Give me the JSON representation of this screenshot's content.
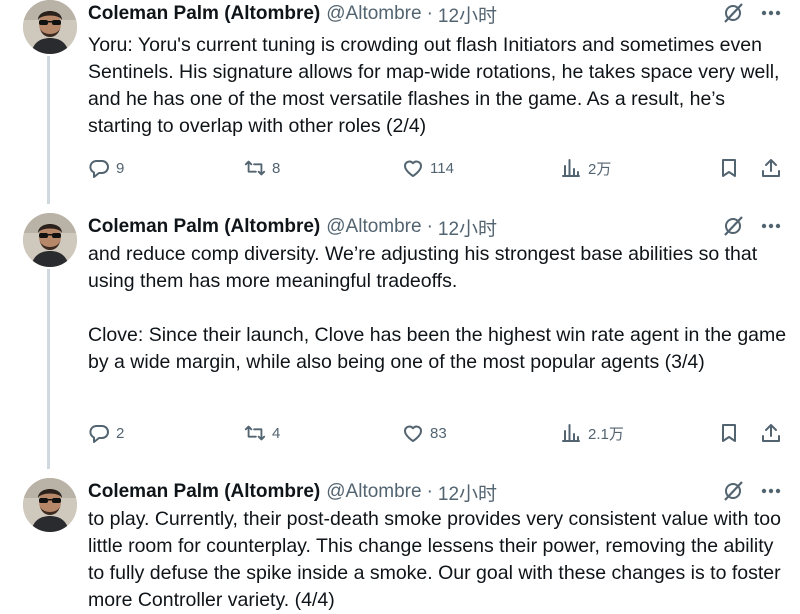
{
  "tweets": [
    {
      "author_name": "Coleman Palm (Altombre)",
      "handle": "@Altombre",
      "separator": "·",
      "time": "12小时",
      "paragraphs": [
        "Yoru: Yoru's current tuning is crowding out flash Initiators and sometimes even Sentinels. His signature allows for map-wide rotations, he takes space very well, and he has one of the most versatile flashes in the game. As a result, he’s starting to overlap with other roles (2/4)"
      ],
      "replies": "9",
      "reposts": "8",
      "likes": "114",
      "views": "2万"
    },
    {
      "author_name": "Coleman Palm (Altombre)",
      "handle": "@Altombre",
      "separator": "·",
      "time": "12小时",
      "paragraphs": [
        "and reduce comp diversity. We’re adjusting his strongest base abilities so that using them has more meaningful tradeoffs.",
        "Clove: Since their launch, Clove has been the highest win rate agent in the game by a wide margin, while also being one of the most popular agents (3/4)"
      ],
      "replies": "2",
      "reposts": "4",
      "likes": "83",
      "views": "2.1万"
    },
    {
      "author_name": "Coleman Palm (Altombre)",
      "handle": "@Altombre",
      "separator": "·",
      "time": "12小时",
      "paragraphs": [
        "to play. Currently, their post-death smoke provides very consistent value with too little room for counterplay. This change lessens their power, removing the ability to fully defuse the spike inside a smoke. Our goal with these changes is to foster more Controller variety. (4/4)"
      ]
    }
  ],
  "icons": {
    "grok": "grok-slash-icon",
    "more": "more-dots-icon",
    "reply": "reply-bubble-icon",
    "repost": "repost-arrows-icon",
    "like": "heart-icon",
    "views": "views-bars-icon",
    "bookmark": "bookmark-icon",
    "share": "share-upload-icon"
  },
  "colors": {
    "text": "#0f1419",
    "muted": "#536471",
    "thread_line": "#cfd9de"
  }
}
